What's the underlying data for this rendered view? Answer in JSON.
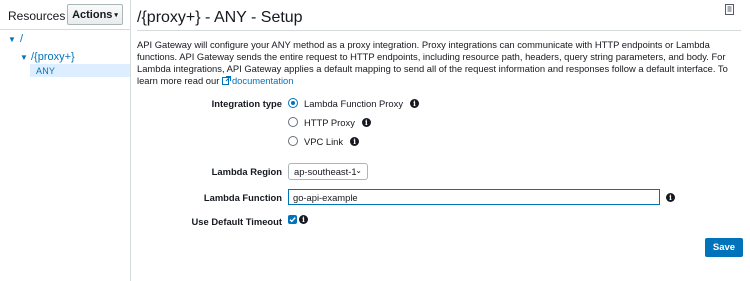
{
  "sidebar": {
    "resources_label": "Resources",
    "actions_label": "Actions",
    "tree": {
      "root": "/",
      "proxy": "/{proxy+}",
      "method": "ANY"
    }
  },
  "header": {
    "title": "/{proxy+} - ANY - Setup"
  },
  "description": {
    "text": "API Gateway will configure your ANY method as a proxy integration. Proxy integrations can communicate with HTTP endpoints or Lambda functions. API Gateway sends the entire request to HTTP endpoints, including resource path, headers, query string parameters, and body. For Lambda integrations, API Gateway applies a default mapping to send all of the request information and responses follow a default interface. To learn more read our ",
    "link": "documentation"
  },
  "form": {
    "integration_type_label": "Integration type",
    "integration_options": [
      "Lambda Function Proxy",
      "HTTP Proxy",
      "VPC Link"
    ],
    "selected_integration": "Lambda Function Proxy",
    "region_label": "Lambda Region",
    "region_value": "ap-southeast-1",
    "function_label": "Lambda Function",
    "function_value": "go-api-example",
    "timeout_label": "Use Default Timeout",
    "timeout_checked": true,
    "save_label": "Save"
  },
  "colors": {
    "accent": "#0073bb",
    "selected_bg": "#dceeff",
    "border": "#d5dbdb"
  }
}
